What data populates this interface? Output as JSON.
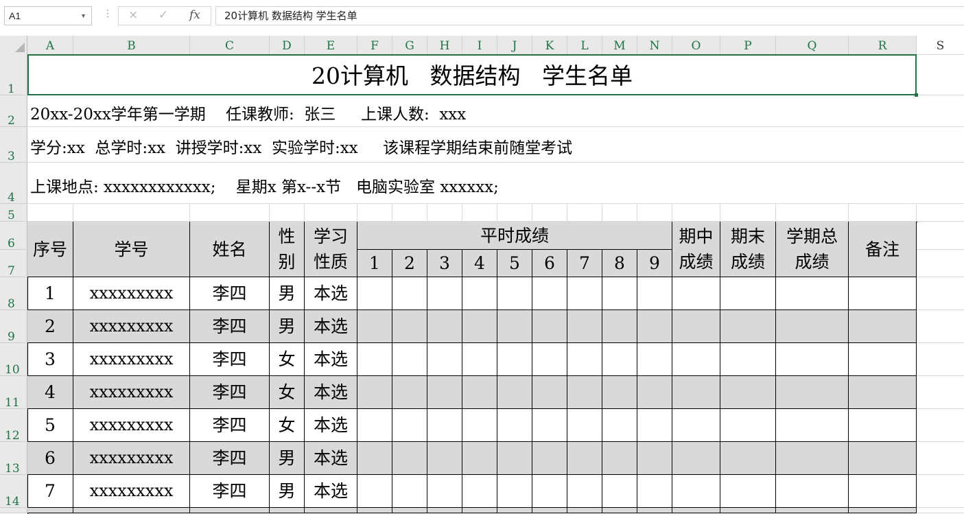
{
  "formula_bar": {
    "name_box": "A1",
    "cancel_icon": "×",
    "enter_icon": "✓",
    "fx_label": "fx",
    "content": "20计算机 数据结构 学生名单"
  },
  "columns": [
    "A",
    "B",
    "C",
    "D",
    "E",
    "F",
    "G",
    "H",
    "I",
    "J",
    "K",
    "L",
    "M",
    "N",
    "O",
    "P",
    "Q",
    "R",
    "S"
  ],
  "rows": [
    "1",
    "2",
    "3",
    "4",
    "5",
    "6",
    "7",
    "8",
    "9",
    "10",
    "11",
    "12",
    "13",
    "14"
  ],
  "sheet": {
    "title": "20计算机   数据结构   学生名单",
    "info_line1": "20xx-20xx学年第一学期    任课教师:  张三     上课人数:  xxx",
    "info_line2": "学分:xx  总学时:xx  讲授学时:xx  实验学时:xx     该课程学期结束前随堂考试",
    "info_line3": "上课地点: xxxxxxxxxxxx;    星期x 第x--x节   电脑实验室 xxxxxx;"
  },
  "table": {
    "headers": {
      "seq": "序号",
      "id": "学号",
      "name": "姓名",
      "gender": "性\n别",
      "study_type": "学习\n性质",
      "usual_grades": "平时成绩",
      "midterm": "期中\n成绩",
      "final": "期末\n成绩",
      "total": "学期总\n成绩",
      "note": "备注"
    },
    "sub_cols": [
      "1",
      "2",
      "3",
      "4",
      "5",
      "6",
      "7",
      "8",
      "9"
    ],
    "rows": [
      {
        "seq": "1",
        "id": "xxxxxxxxx",
        "name": "李四",
        "gender": "男",
        "type": "本选"
      },
      {
        "seq": "2",
        "id": "xxxxxxxxx",
        "name": "李四",
        "gender": "男",
        "type": "本选"
      },
      {
        "seq": "3",
        "id": "xxxxxxxxx",
        "name": "李四",
        "gender": "女",
        "type": "本选"
      },
      {
        "seq": "4",
        "id": "xxxxxxxxx",
        "name": "李四",
        "gender": "女",
        "type": "本选"
      },
      {
        "seq": "5",
        "id": "xxxxxxxxx",
        "name": "李四",
        "gender": "女",
        "type": "本选"
      },
      {
        "seq": "6",
        "id": "xxxxxxxxx",
        "name": "李四",
        "gender": "男",
        "type": "本选"
      },
      {
        "seq": "7",
        "id": "xxxxxxxxx",
        "name": "李四",
        "gender": "男",
        "type": "本选"
      }
    ]
  },
  "colors": {
    "accent": "#217346",
    "header_bg": "#e9e9e9",
    "band_gray": "#d9d9d9"
  }
}
